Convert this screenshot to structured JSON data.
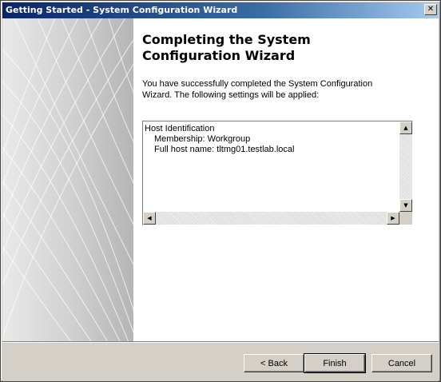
{
  "window": {
    "title": "Getting Started - System Configuration Wizard",
    "close_glyph": "✕"
  },
  "page": {
    "heading_line1": "Completing the System",
    "heading_line2": "Configuration Wizard",
    "intro_line1": "You have successfully completed the System Configuration",
    "intro_line2": "Wizard. The following settings will be applied:"
  },
  "settings": {
    "section": "Host Identification",
    "membership": "Membership: Workgroup",
    "fqdn": "Full host name: tltmg01.testlab.local"
  },
  "scrollbar_glyphs": {
    "up": "▲",
    "down": "▼",
    "left": "◀",
    "right": "▶"
  },
  "buttons": {
    "back": "< Back",
    "finish": "Finish",
    "cancel": "Cancel"
  },
  "colors": {
    "titlebar_start": "#0a246a",
    "titlebar_end": "#a6caf0",
    "dialog_bg": "#d4d0c8"
  }
}
